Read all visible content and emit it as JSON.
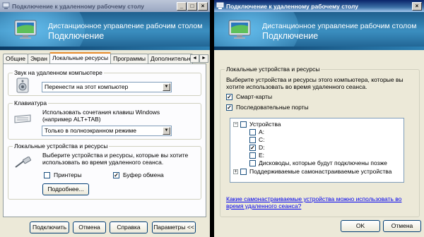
{
  "left": {
    "title": "Подключение к удаленному рабочему столу",
    "banner_line1": "Дистанционное управление рабочим столом",
    "banner_line2": "Подключение",
    "tabs": [
      "Общие",
      "Экран",
      "Локальные ресурсы",
      "Программы",
      "Дополнительн"
    ],
    "active_tab": 2,
    "sound_group": "Звук на удаленном компьютере",
    "sound_value": "Перенести на этот компьютер",
    "keyboard_group": "Клавиатура",
    "keyboard_text": "Использовать сочетания клавиш Windows (например ALT+TAB)",
    "keyboard_value": "Только в полноэкранном режиме",
    "local_group": "Локальные устройства и ресурсы",
    "local_text": "Выберите устройства и ресурсы, которые вы хотите использовать во время удаленного сеанса.",
    "printers_label": "Принтеры",
    "printers_checked": false,
    "clipboard_label": "Буфер обмена",
    "clipboard_checked": true,
    "more_button": "Подробнее...",
    "connect_button": "Подключить",
    "cancel_button": "Отмена",
    "help_button": "Справка",
    "options_button": "Параметры <<"
  },
  "right": {
    "title": "Подключение к удаленному рабочему столу",
    "banner_line1": "Дистанционное управление рабочим столом",
    "banner_line2": "Подключение",
    "group_label": "Локальные устройства и ресурсы",
    "intro_text": "Выберите устройства и ресурсы этого компьютера, которые вы хотите использовать во время удаленного сеанса.",
    "smartcards_label": "Смарт-карты",
    "smartcards_checked": true,
    "ports_label": "Последовательные порты",
    "ports_checked": true,
    "tree": {
      "drives_label": "Устройства",
      "drives_checked": false,
      "drives": [
        {
          "label": "A:",
          "checked": false
        },
        {
          "label": "C:",
          "checked": false
        },
        {
          "label": "D:",
          "checked": true
        },
        {
          "label": "E:",
          "checked": false
        },
        {
          "label": "Дисководы, которые будут подключены позже",
          "checked": false
        }
      ],
      "pnp_label": "Поддерживаемые самонастраиваемые устройства",
      "pnp_checked": false
    },
    "link_text": "Какие самонастраиваемые устройства можно использовать во время удаленного сеанса?",
    "ok_button": "OK",
    "cancel_button": "Отмена"
  }
}
